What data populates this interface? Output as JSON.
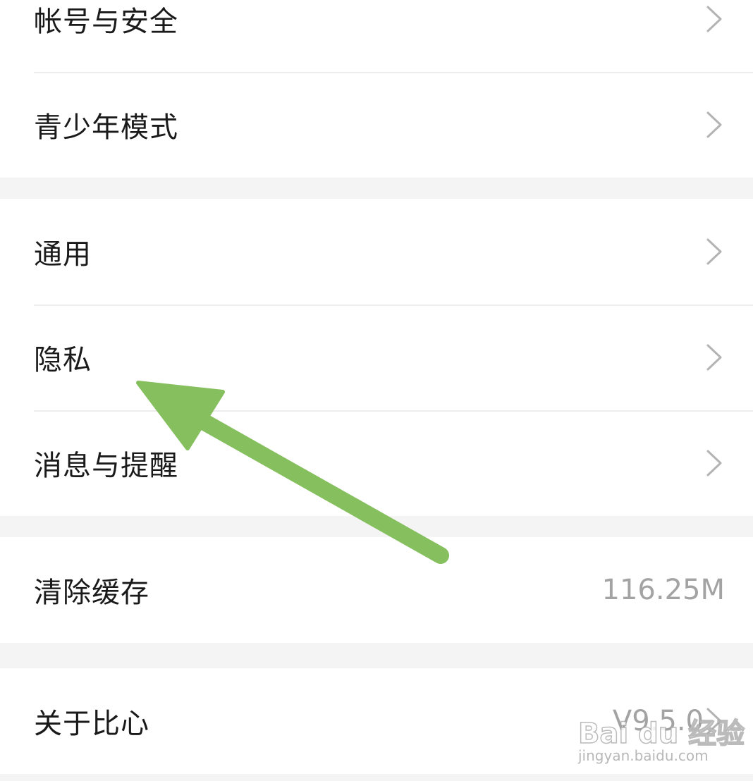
{
  "settings": {
    "group1": [
      {
        "label": "帐号与安全"
      },
      {
        "label": "青少年模式"
      }
    ],
    "group2": [
      {
        "label": "通用"
      },
      {
        "label": "隐私"
      },
      {
        "label": "消息与提醒"
      }
    ],
    "group3": [
      {
        "label": "清除缓存",
        "value": "116.25M"
      }
    ],
    "group4": [
      {
        "label": "关于比心",
        "value": "V9.5.0"
      }
    ]
  },
  "annotation": {
    "arrow_color": "#85bf5e",
    "points_to": "隐私"
  },
  "watermark": {
    "brand": "Bai du 经验",
    "url": "jingyan.baidu.com"
  },
  "colors": {
    "background": "#f4f4f4",
    "row_background": "#ffffff",
    "label_text": "#1a1a1a",
    "secondary_text": "#a3a3a3",
    "chevron": "#b3b3b3",
    "divider": "#ececec"
  }
}
